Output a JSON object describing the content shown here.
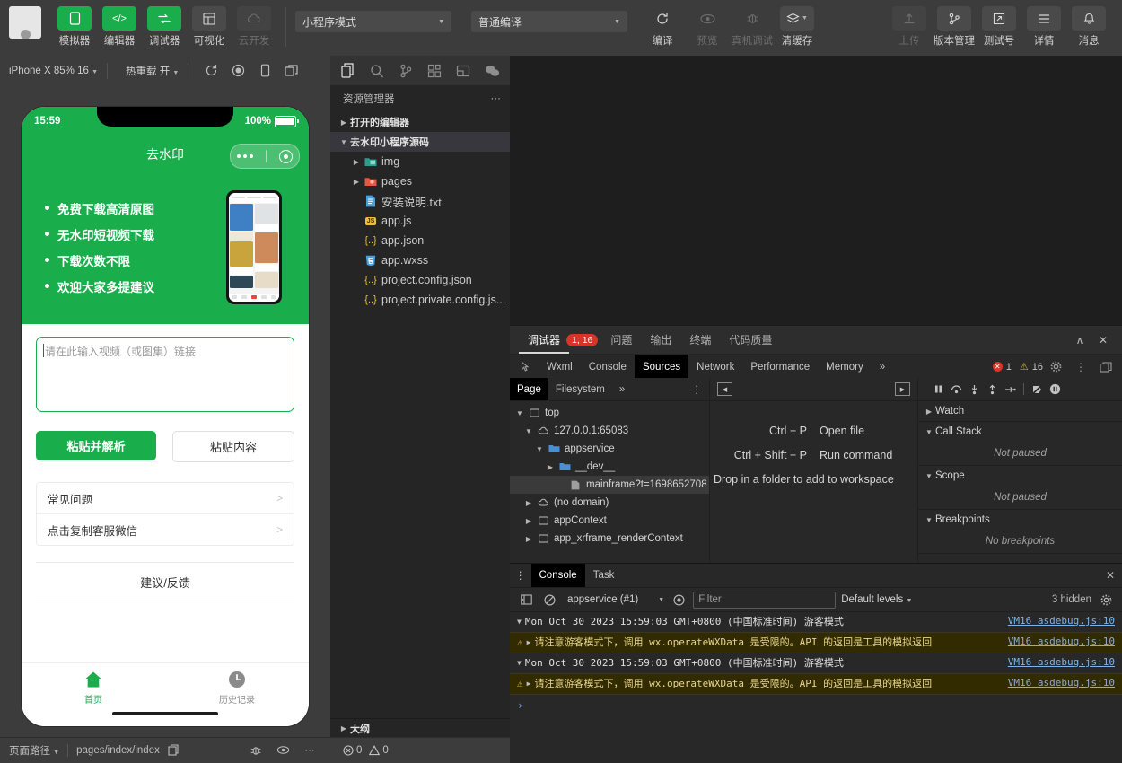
{
  "toolbar": {
    "items": [
      {
        "label": "模拟器",
        "icon": "phone-icon",
        "state": "green"
      },
      {
        "label": "编辑器",
        "icon": "code-icon",
        "state": "green"
      },
      {
        "label": "调试器",
        "icon": "debug-swap-icon",
        "state": "green"
      },
      {
        "label": "可视化",
        "icon": "layout-icon",
        "state": "normal"
      },
      {
        "label": "云开发",
        "icon": "cloud-icon",
        "state": "disabled"
      }
    ],
    "mode_select": "小程序模式",
    "compile_select": "普通编译",
    "actions": [
      {
        "label": "编译",
        "icon": "refresh-icon",
        "state": "normal"
      },
      {
        "label": "预览",
        "icon": "eye-icon",
        "state": "disabled"
      },
      {
        "label": "真机调试",
        "icon": "bug-icon",
        "state": "disabled"
      },
      {
        "label": "清缓存",
        "icon": "layers-icon",
        "state": "normal"
      }
    ],
    "right_actions": [
      {
        "label": "上传",
        "icon": "upload-icon",
        "state": "disabled"
      },
      {
        "label": "版本管理",
        "icon": "git-branch-icon",
        "state": "normal"
      },
      {
        "label": "测试号",
        "icon": "external-link-icon",
        "state": "normal"
      },
      {
        "label": "详情",
        "icon": "menu-icon",
        "state": "normal"
      },
      {
        "label": "消息",
        "icon": "bell-icon",
        "state": "normal"
      }
    ]
  },
  "simulator": {
    "device": "iPhone X 85% 16",
    "hot_reload": "热重载 开",
    "icons": [
      "rotate-icon",
      "record-icon",
      "phone-frame-icon",
      "multi-window-icon"
    ],
    "status_time": "15:59",
    "battery": "100%",
    "nav_title": "去水印",
    "bullets": [
      "免费下载高清原图",
      "无水印短视频下载",
      "下载次数不限",
      "欢迎大家多提建议"
    ],
    "input_placeholder": "请在此输入视频（或图集）链接",
    "btn_primary": "粘贴并解析",
    "btn_ghost": "粘贴内容",
    "cells": [
      {
        "label": "常见问题",
        "arrow": ">"
      },
      {
        "label": "点击复制客服微信",
        "arrow": ">"
      }
    ],
    "feedback": "建议/反馈",
    "tabbar": [
      {
        "label": "首页",
        "icon": "home-icon",
        "active": true
      },
      {
        "label": "历史记录",
        "icon": "clock-icon",
        "active": false
      }
    ],
    "footer": {
      "page_path_label": "页面路径",
      "page_path": "pages/index/index",
      "icons": [
        "copy-icon",
        "bug-icon",
        "eye-icon",
        "more-icon"
      ]
    }
  },
  "explorer": {
    "activity_icons": [
      "files-icon",
      "search-icon",
      "source-control-icon",
      "extensions-icon",
      "split-editor-icon",
      "wechat-icon"
    ],
    "title": "资源管理器",
    "more": "···",
    "sections": [
      {
        "label": "打开的编辑器",
        "expanded": false
      },
      {
        "label": "去水印小程序源码",
        "expanded": true
      }
    ],
    "files": [
      {
        "name": "img",
        "type": "folder",
        "indent": 2,
        "twisty": "▸",
        "color": "#2a9d8f"
      },
      {
        "name": "pages",
        "type": "folder",
        "indent": 2,
        "twisty": "▸",
        "color": "#e05a45"
      },
      {
        "name": "安装说明.txt",
        "type": "txt",
        "indent": 3,
        "twisty": "",
        "color": "#4a9fd8"
      },
      {
        "name": "app.js",
        "type": "js",
        "indent": 3,
        "twisty": "",
        "color": "#e8c03c"
      },
      {
        "name": "app.json",
        "type": "json",
        "indent": 3,
        "twisty": "",
        "color": "#e8c03c"
      },
      {
        "name": "app.wxss",
        "type": "wxss",
        "indent": 3,
        "twisty": "",
        "color": "#4a9fd8"
      },
      {
        "name": "project.config.json",
        "type": "json",
        "indent": 3,
        "twisty": "",
        "color": "#e8c03c"
      },
      {
        "name": "project.private.config.js...",
        "type": "json",
        "indent": 3,
        "twisty": "",
        "color": "#e8c03c"
      }
    ],
    "outline": "大纲",
    "status": {
      "errors": "0",
      "warnings": "0"
    }
  },
  "devtools": {
    "top_tabs": [
      {
        "label": "调试器",
        "active": true,
        "badge": "1, 16"
      },
      {
        "label": "问题",
        "active": false
      },
      {
        "label": "输出",
        "active": false
      },
      {
        "label": "终端",
        "active": false
      },
      {
        "label": "代码质量",
        "active": false
      }
    ],
    "panel_tabs": [
      {
        "label": "Wxml",
        "active": false
      },
      {
        "label": "Console",
        "active": false
      },
      {
        "label": "Sources",
        "active": true
      },
      {
        "label": "Network",
        "active": false
      },
      {
        "label": "Performance",
        "active": false
      },
      {
        "label": "Memory",
        "active": false
      },
      {
        "label": "»",
        "active": false
      }
    ],
    "error_count": "1",
    "warning_count": "16",
    "sources": {
      "tabs": [
        {
          "label": "Page",
          "active": true
        },
        {
          "label": "Filesystem",
          "active": false
        },
        {
          "label": "»",
          "active": false
        }
      ],
      "tree": [
        {
          "label": "top",
          "indent": 0,
          "twisty": "▾",
          "icon": "frame-icon",
          "selected": false
        },
        {
          "label": "127.0.0.1:65083",
          "indent": 1,
          "twisty": "▾",
          "icon": "cloud-icon",
          "selected": false
        },
        {
          "label": "appservice",
          "indent": 2,
          "twisty": "▾",
          "icon": "folder-icon",
          "selected": false
        },
        {
          "label": "__dev__",
          "indent": 3,
          "twisty": "▸",
          "icon": "folder-icon",
          "selected": false
        },
        {
          "label": "mainframe?t=1698652708",
          "indent": 4,
          "twisty": "",
          "icon": "file-icon",
          "selected": true
        },
        {
          "label": "(no domain)",
          "indent": 1,
          "twisty": "▸",
          "icon": "cloud-icon",
          "selected": false
        },
        {
          "label": "appContext",
          "indent": 1,
          "twisty": "▸",
          "icon": "frame-icon",
          "selected": false
        },
        {
          "label": "app_xrframe_renderContext",
          "indent": 1,
          "twisty": "▸",
          "icon": "frame-icon",
          "selected": false
        }
      ],
      "hints": [
        {
          "key": "Ctrl + P",
          "action": "Open file"
        },
        {
          "key": "Ctrl + Shift + P",
          "action": "Run command"
        }
      ],
      "drop_hint": "Drop in a folder to add to workspace"
    },
    "debugger": {
      "controls": [
        "pause-icon",
        "step-over-icon",
        "step-into-icon",
        "step-out-icon",
        "step-icon",
        "deactivate-breakpoints-icon",
        "pause-exceptions-icon"
      ],
      "sections": [
        {
          "label": "Watch",
          "twisty": "▸",
          "body": ""
        },
        {
          "label": "Call Stack",
          "twisty": "▾",
          "body": "Not paused"
        },
        {
          "label": "Scope",
          "twisty": "▾",
          "body": "Not paused"
        },
        {
          "label": "Breakpoints",
          "twisty": "▾",
          "body": "No breakpoints"
        }
      ]
    },
    "console": {
      "tabs": [
        {
          "label": "Console",
          "active": true
        },
        {
          "label": "Task",
          "active": false
        }
      ],
      "context": "appservice (#1)",
      "filter_placeholder": "Filter",
      "levels": "Default levels",
      "hidden": "3 hidden",
      "messages": [
        {
          "type": "group",
          "text": "Mon Oct 30 2023 15:59:03 GMT+0800 (中国标准时间) 游客模式",
          "source": "VM16 asdebug.js:10"
        },
        {
          "type": "warning",
          "text": "请注意游客模式下，调用 wx.operateWXData 是受限的。API 的返回是工具的模拟返回",
          "source": "VM16 asdebug.js:10"
        },
        {
          "type": "group",
          "text": "Mon Oct 30 2023 15:59:03 GMT+0800 (中国标准时间) 游客模式",
          "source": "VM16 asdebug.js:10"
        },
        {
          "type": "warning",
          "text": "请注意游客模式下，调用 wx.operateWXData 是受限的。API 的返回是工具的模拟返回",
          "source": "VM16 asdebug.js:10"
        }
      ],
      "prompt": "›"
    }
  },
  "colors": {
    "brand_green": "#1aad4b",
    "toolbar_bg": "#3c3c3c",
    "editor_bg": "#1e1e1e",
    "explorer_bg": "#252526",
    "devtools_bg": "#282828",
    "warning_bg": "#332b00",
    "error_red": "#d8342a"
  }
}
